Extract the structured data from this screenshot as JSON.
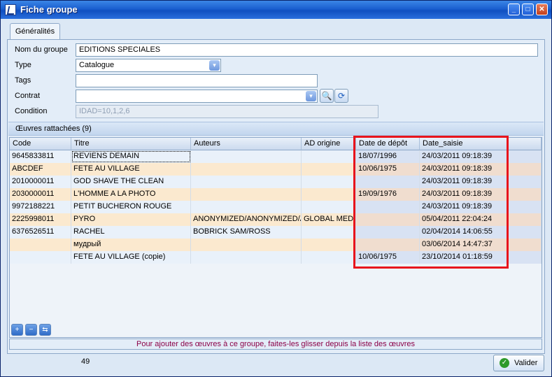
{
  "window": {
    "title": "Fiche groupe",
    "minimize_glyph": "_",
    "maximize_glyph": "□",
    "close_glyph": "✕"
  },
  "tabs": [
    {
      "label": "Généralités"
    }
  ],
  "form": {
    "nom_label": "Nom du groupe",
    "nom_value": "EDITIONS SPECIALES",
    "type_label": "Type",
    "type_value": "Catalogue",
    "tags_label": "Tags",
    "tags_value": "",
    "contrat_label": "Contrat",
    "contrat_value": "",
    "condition_label": "Condition",
    "condition_value": "IDAD=10,1,2,6"
  },
  "works": {
    "header": "Œuvres rattachées (9)",
    "columns": [
      "Code",
      "Titre",
      "Auteurs",
      "AD origine",
      "Date de dépôt",
      "Date_saisie"
    ],
    "rows": [
      {
        "code": "9645833811",
        "titre": "REVIENS DEMAIN",
        "auteurs": "",
        "ad": "",
        "depot": "18/07/1996",
        "saisie": "24/03/2011 09:18:39"
      },
      {
        "code": "ABCDEF",
        "titre": "FETE AU VILLAGE",
        "auteurs": "",
        "ad": "",
        "depot": "10/06/1975",
        "saisie": "24/03/2011 09:18:39"
      },
      {
        "code": "2010000011",
        "titre": "GOD SHAVE THE CLEAN",
        "auteurs": "",
        "ad": "",
        "depot": "",
        "saisie": "24/03/2011 09:18:39"
      },
      {
        "code": "2030000011",
        "titre": "L'HOMME A LA PHOTO",
        "auteurs": "",
        "ad": "",
        "depot": "19/09/1976",
        "saisie": "24/03/2011 09:18:39"
      },
      {
        "code": "9972188221",
        "titre": "PETIT BUCHERON ROUGE",
        "auteurs": "",
        "ad": "",
        "depot": "",
        "saisie": "24/03/2011 09:18:39"
      },
      {
        "code": "2225998011",
        "titre": "PYRO",
        "auteurs": "ANONYMIZED/ANONYMIZED/A",
        "ad": "GLOBAL MEDIA",
        "depot": "",
        "saisie": "05/04/2011 22:04:24"
      },
      {
        "code": "6376526511",
        "titre": "RACHEL",
        "auteurs": "BOBRICK SAM/ROSS",
        "ad": "",
        "depot": "",
        "saisie": "02/04/2014 14:06:55"
      },
      {
        "code": "",
        "titre": "мудрый",
        "auteurs": "",
        "ad": "",
        "depot": "",
        "saisie": "03/06/2014 14:47:37"
      },
      {
        "code": "",
        "titre": "FETE AU VILLAGE (copie)",
        "auteurs": "",
        "ad": "",
        "depot": "10/06/1975",
        "saisie": "23/10/2014 01:18:59"
      }
    ],
    "hint": "Pour ajouter des œuvres à ce groupe, faites-les glisser depuis la liste des œuvres"
  },
  "footer": {
    "count": "49",
    "validate_label": "Valider"
  },
  "colors": {
    "title_bar": "#1a5fd0",
    "highlight_box": "#e8141c",
    "hint_text": "#8b0047",
    "row_alt": "#fbe9cf",
    "row_normal": "#e9f1fa"
  },
  "icons": {
    "dropdown": "▾",
    "search": "🔍",
    "refresh": "⟳",
    "ok": "✓",
    "add": "+",
    "remove": "−",
    "link": "⇆"
  }
}
